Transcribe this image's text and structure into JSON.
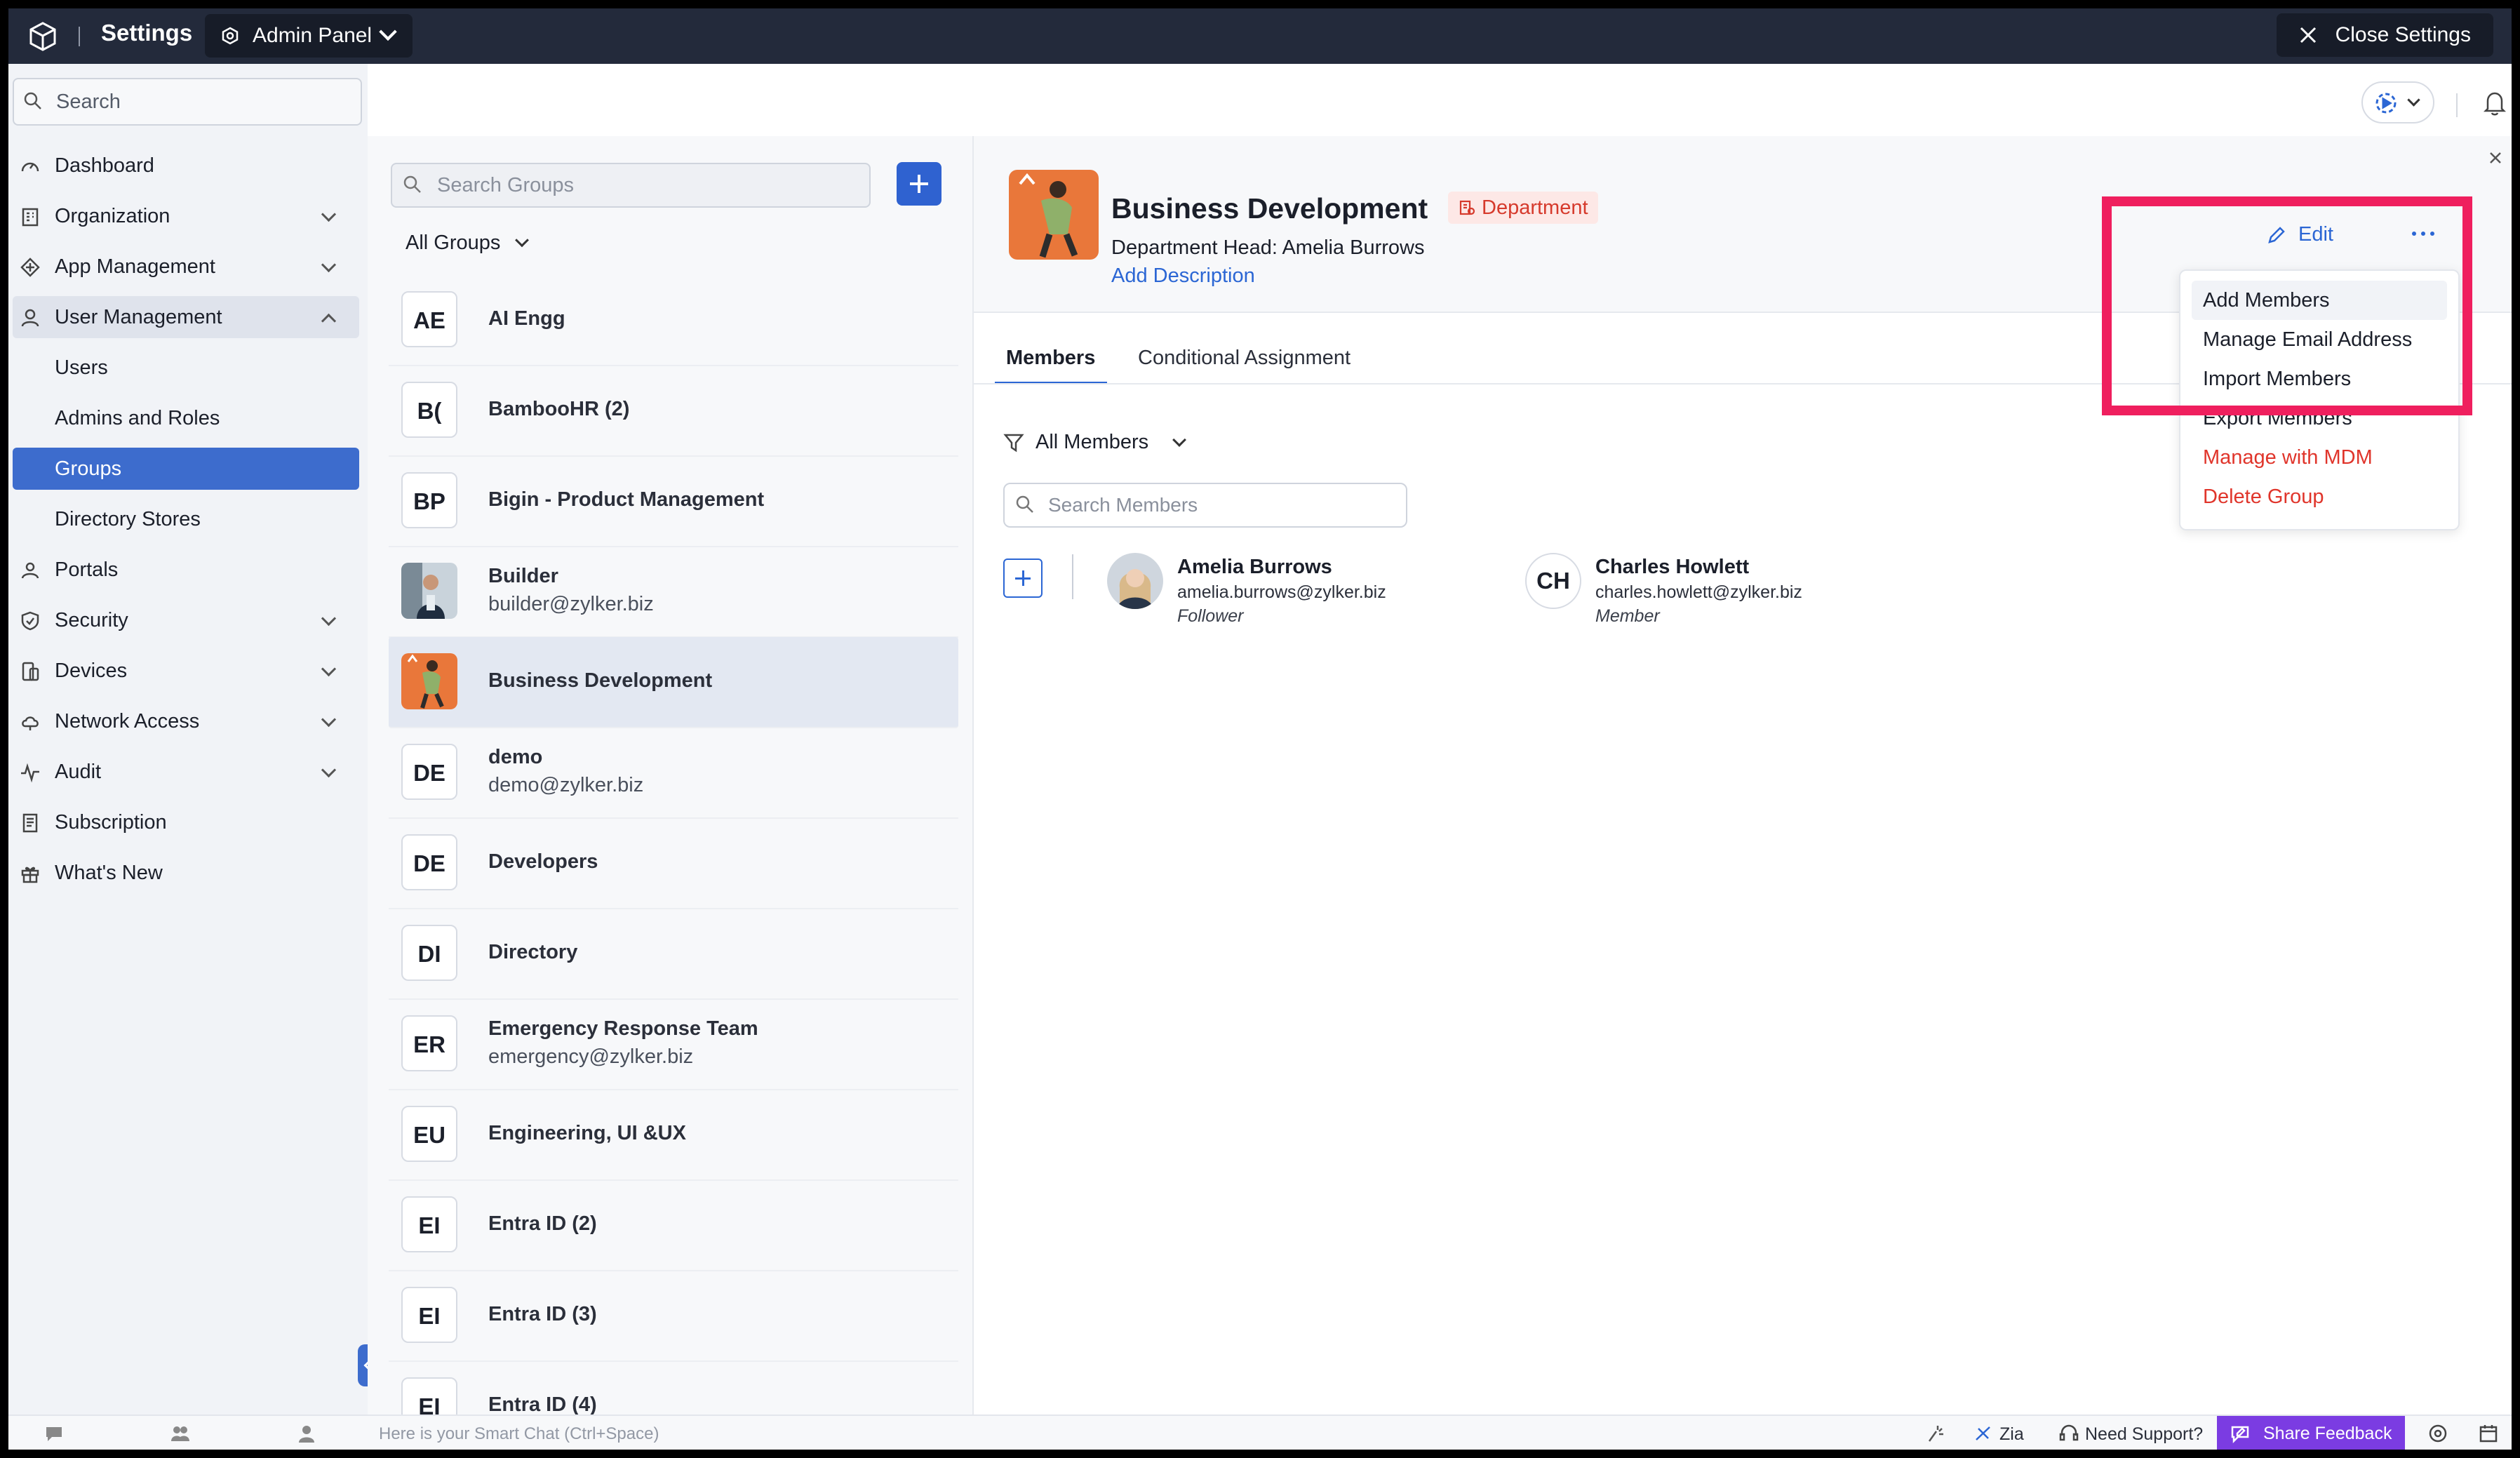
{
  "topbar": {
    "title": "Settings",
    "panel": "Admin Panel",
    "close": "Close Settings"
  },
  "sidebar": {
    "search_placeholder": "Search",
    "items": [
      {
        "label": "Dashboard",
        "icon": "dashboard-icon"
      },
      {
        "label": "Organization",
        "icon": "organization-icon"
      },
      {
        "label": "App Management",
        "icon": "app-management-icon"
      },
      {
        "label": "User Management",
        "icon": "user-icon"
      },
      {
        "label": "Users"
      },
      {
        "label": "Admins and Roles"
      },
      {
        "label": "Groups"
      },
      {
        "label": "Directory Stores"
      },
      {
        "label": "Portals",
        "icon": "portals-icon"
      },
      {
        "label": "Security",
        "icon": "shield-icon"
      },
      {
        "label": "Devices",
        "icon": "devices-icon"
      },
      {
        "label": "Network Access",
        "icon": "cloud-icon"
      },
      {
        "label": "Audit",
        "icon": "activity-icon"
      },
      {
        "label": "Subscription",
        "icon": "receipt-icon"
      },
      {
        "label": "What's New",
        "icon": "gift-icon"
      }
    ]
  },
  "groups": {
    "search_placeholder": "Search Groups",
    "filter": "All Groups",
    "list": [
      {
        "initials": "AE",
        "name": "AI Engg"
      },
      {
        "initials": "B(",
        "name": "BambooHR (2)"
      },
      {
        "initials": "BP",
        "name": "Bigin - Product Management"
      },
      {
        "initials": "",
        "name": "Builder",
        "email": "builder@zylker.biz"
      },
      {
        "initials": "",
        "name": "Business Development"
      },
      {
        "initials": "DE",
        "name": "demo",
        "email": "demo@zylker.biz"
      },
      {
        "initials": "DE",
        "name": "Developers"
      },
      {
        "initials": "DI",
        "name": "Directory"
      },
      {
        "initials": "ER",
        "name": "Emergency Response Team",
        "email": "emergency@zylker.biz"
      },
      {
        "initials": "EU",
        "name": "Engineering, UI &UX"
      },
      {
        "initials": "EI",
        "name": "Entra ID (2)"
      },
      {
        "initials": "EI",
        "name": "Entra ID (3)"
      },
      {
        "initials": "EI",
        "name": "Entra ID (4)"
      }
    ]
  },
  "detail": {
    "name": "Business Development",
    "badge": "Department",
    "head_label": "Department Head:",
    "head_name": "Amelia Burrows",
    "add_description": "Add Description",
    "edit": "Edit",
    "tabs": [
      "Members",
      "Conditional Assignment"
    ],
    "member_filter": "All Members",
    "member_search_placeholder": "Search Members",
    "members": [
      {
        "name": "Amelia Burrows",
        "email": "amelia.burrows@zylker.biz",
        "role": "Follower",
        "initials": ""
      },
      {
        "name": "Charles Howlett",
        "email": "charles.howlett@zylker.biz",
        "role": "Member",
        "initials": "CH"
      }
    ]
  },
  "menu": {
    "items": [
      "Add Members",
      "Manage Email Address",
      "Import Members",
      "Export Members",
      "Manage with MDM",
      "Delete Group"
    ]
  },
  "footer": {
    "chat_placeholder": "Here is your Smart Chat (Ctrl+Space)",
    "zia": "Zia",
    "support": "Need Support?",
    "feedback": "Share Feedback"
  },
  "colors": {
    "accent": "#2b66d4",
    "selected": "#3d6ccd",
    "topbar": "#232a3b",
    "danger": "#e0352b",
    "highlight_box": "#ef1f5e",
    "feedback": "#7b3ce2"
  }
}
